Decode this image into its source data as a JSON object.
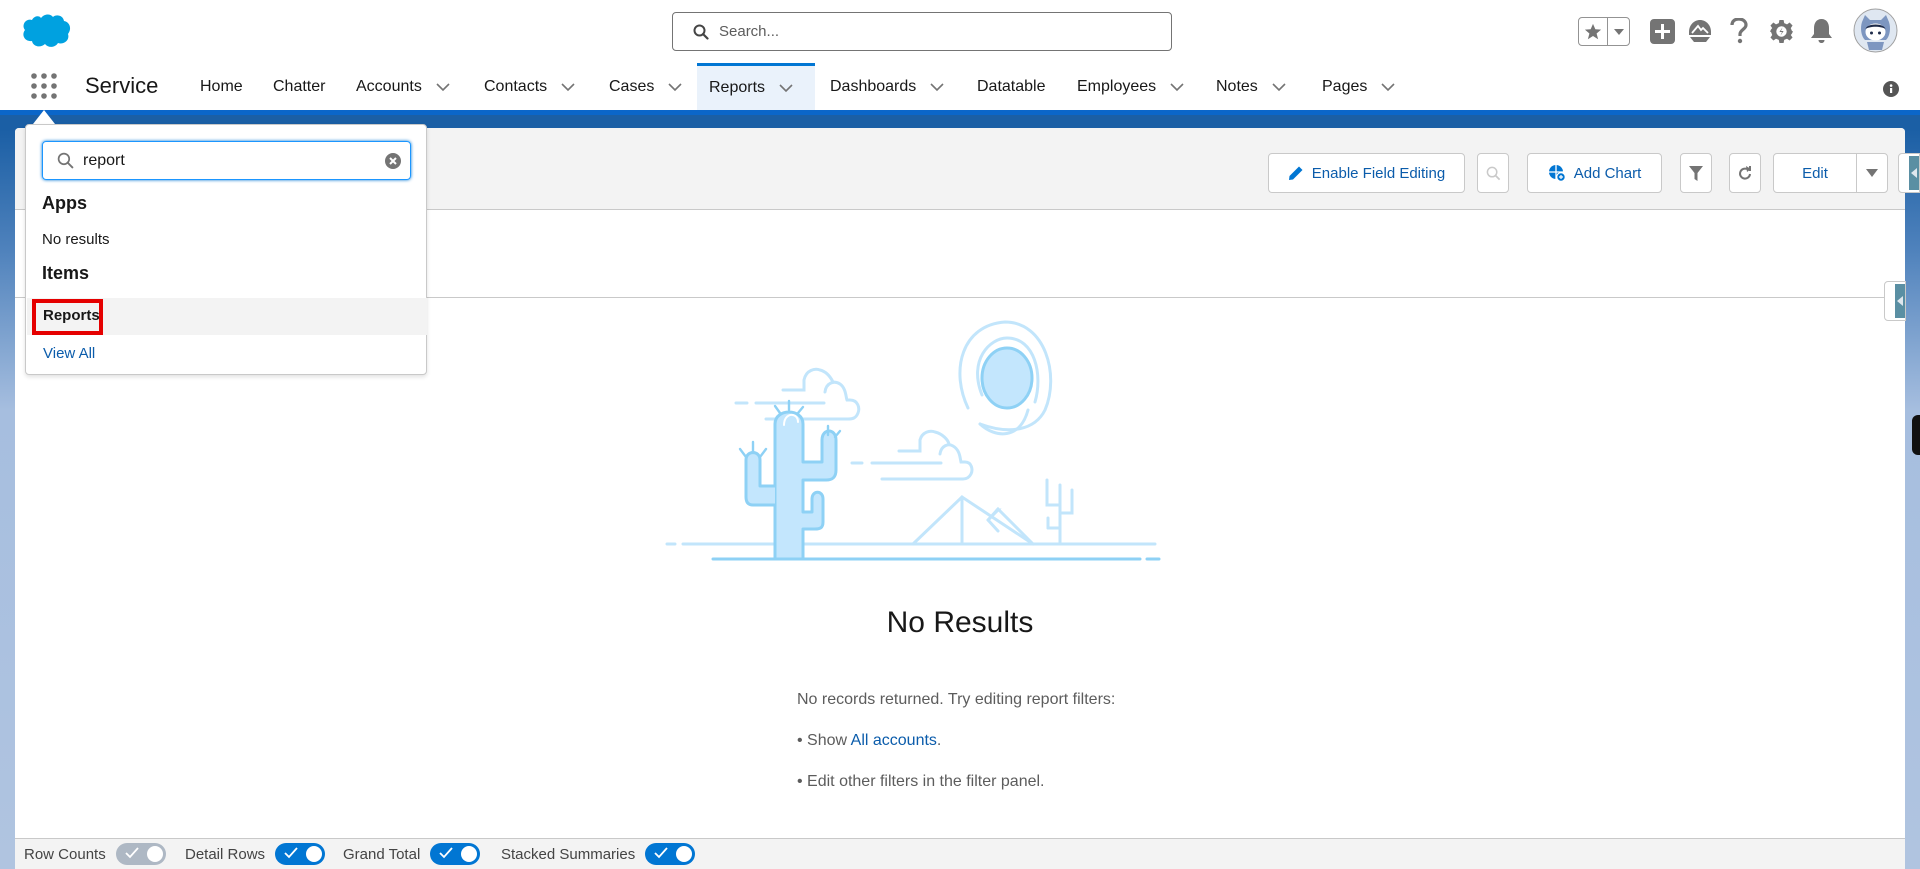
{
  "global_header": {
    "search_placeholder": "Search...",
    "icons": [
      "salesforce-cloud-logo",
      "favorites-star-icon",
      "favorites-menu-icon",
      "global-actions-plus-icon",
      "trailhead-icon",
      "help-icon",
      "setup-gear-icon",
      "notifications-bell-icon",
      "user-avatar"
    ]
  },
  "nav": {
    "app_name": "Service",
    "items": [
      {
        "label": "Home",
        "has_menu": false,
        "active": false
      },
      {
        "label": "Chatter",
        "has_menu": false,
        "active": false
      },
      {
        "label": "Accounts",
        "has_menu": true,
        "active": false
      },
      {
        "label": "Contacts",
        "has_menu": true,
        "active": false
      },
      {
        "label": "Cases",
        "has_menu": true,
        "active": false
      },
      {
        "label": "Reports",
        "has_menu": true,
        "active": true
      },
      {
        "label": "Dashboards",
        "has_menu": true,
        "active": false
      },
      {
        "label": "Datatable",
        "has_menu": false,
        "active": false
      },
      {
        "label": "Employees",
        "has_menu": true,
        "active": false
      },
      {
        "label": "Notes",
        "has_menu": true,
        "active": false
      },
      {
        "label": "Pages",
        "has_menu": true,
        "active": false
      }
    ]
  },
  "toolbar": {
    "enable_field_editing": "Enable Field Editing",
    "add_chart": "Add Chart",
    "edit": "Edit"
  },
  "empty_state": {
    "title": "No Results",
    "message": "No records returned. Try editing report filters:",
    "bullet1_prefix": "• Show ",
    "bullet1_link": "All accounts",
    "bullet1_suffix": ".",
    "bullet2": "• Edit other filters in the filter panel."
  },
  "footer": {
    "toggles": [
      {
        "label": "Row Counts",
        "on": true,
        "disabled": true
      },
      {
        "label": "Detail Rows",
        "on": true,
        "disabled": false
      },
      {
        "label": "Grand Total",
        "on": true,
        "disabled": false
      },
      {
        "label": "Stacked Summaries",
        "on": true,
        "disabled": false
      }
    ]
  },
  "app_launcher": {
    "search_value": "report",
    "apps_heading": "Apps",
    "apps_empty": "No results",
    "items_heading": "Items",
    "items": [
      "Reports"
    ],
    "view_all": "View All"
  },
  "colors": {
    "brand": "#0176d3",
    "link": "#0b5cab",
    "highlight": "#e50000"
  }
}
